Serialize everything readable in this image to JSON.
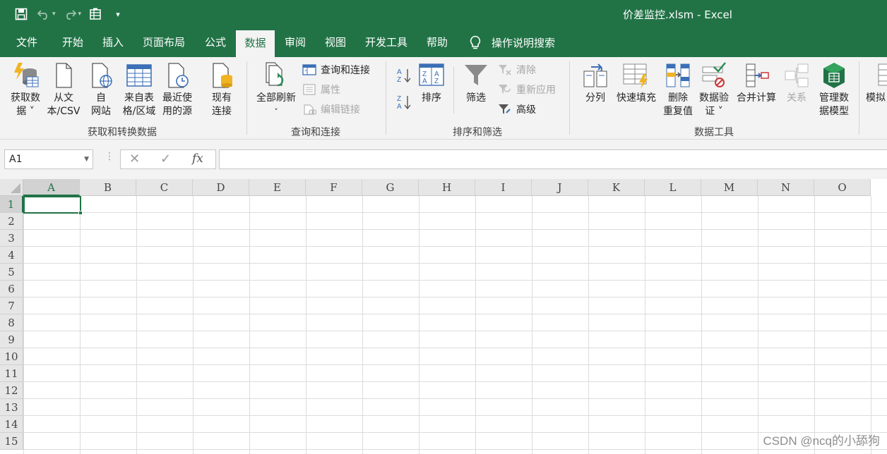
{
  "window": {
    "title": "价差监控.xlsm  -  Excel"
  },
  "quick_access": [
    {
      "name": "save-icon"
    },
    {
      "name": "undo-icon"
    },
    {
      "name": "redo-icon"
    },
    {
      "name": "form-icon"
    },
    {
      "name": "customize-qat-icon"
    }
  ],
  "tabs": [
    {
      "label": "文件"
    },
    {
      "label": "开始"
    },
    {
      "label": "插入"
    },
    {
      "label": "页面布局"
    },
    {
      "label": "公式"
    },
    {
      "label": "数据",
      "active": true
    },
    {
      "label": "审阅"
    },
    {
      "label": "视图"
    },
    {
      "label": "开发工具"
    },
    {
      "label": "帮助"
    }
  ],
  "tell_me": {
    "label": "操作说明搜索",
    "icon": "lightbulb-icon"
  },
  "ribbon": {
    "get_transform": {
      "label": "获取和转换数据",
      "buttons": [
        {
          "line1": "获取数",
          "line2": "据 ˅",
          "icon": "get-data-icon"
        },
        {
          "line1": "从文",
          "line2": "本/CSV",
          "icon": "from-text-icon"
        },
        {
          "line1": "自",
          "line2": "网站",
          "icon": "from-web-icon"
        },
        {
          "line1": "来自表",
          "line2": "格/区域",
          "icon": "from-table-icon"
        },
        {
          "line1": "最近使",
          "line2": "用的源",
          "icon": "recent-sources-icon"
        },
        {
          "line1": "现有",
          "line2": "连接",
          "icon": "existing-connections-icon"
        }
      ]
    },
    "queries": {
      "label": "查询和连接",
      "refresh": {
        "line1": "全部刷新",
        "line2": "˅",
        "icon": "refresh-all-icon"
      },
      "small": [
        {
          "label": "查询和连接",
          "disabled": false,
          "icon": "queries-connections-icon"
        },
        {
          "label": "属性",
          "disabled": true,
          "icon": "properties-icon"
        },
        {
          "label": "编辑链接",
          "disabled": true,
          "icon": "edit-links-icon"
        }
      ]
    },
    "sort_filter": {
      "label": "排序和筛选",
      "sort_label": "排序",
      "filter_label": "筛选",
      "small": [
        {
          "label": "清除",
          "disabled": true,
          "icon": "clear-filter-icon"
        },
        {
          "label": "重新应用",
          "disabled": true,
          "icon": "reapply-icon"
        },
        {
          "label": "高级",
          "disabled": false,
          "icon": "advanced-filter-icon"
        }
      ]
    },
    "data_tools": {
      "label": "数据工具",
      "buttons": [
        {
          "line1": "分列",
          "line2": "",
          "icon": "text-to-columns-icon",
          "disabled": false
        },
        {
          "line1": "快速填充",
          "line2": "",
          "icon": "flash-fill-icon",
          "disabled": false
        },
        {
          "line1": "删除",
          "line2": "重复值",
          "icon": "remove-duplicates-icon",
          "disabled": false
        },
        {
          "line1": "数据验",
          "line2": "证 ˅",
          "icon": "data-validation-icon",
          "disabled": false
        },
        {
          "line1": "合并计算",
          "line2": "",
          "icon": "consolidate-icon",
          "disabled": false
        },
        {
          "line1": "关系",
          "line2": "",
          "icon": "relationships-icon",
          "disabled": true
        },
        {
          "line1": "管理数",
          "line2": "据模型",
          "icon": "data-model-icon",
          "disabled": false
        }
      ]
    },
    "forecast": {
      "line1": "模拟"
    }
  },
  "formula_bar": {
    "name_box": "A1",
    "cancel": "✕",
    "enter": "✓",
    "fx": "fx",
    "value": ""
  },
  "sheet": {
    "columns": [
      "A",
      "B",
      "C",
      "D",
      "E",
      "F",
      "G",
      "H",
      "I",
      "J",
      "K",
      "L",
      "M",
      "N",
      "O"
    ],
    "rows": [
      "1",
      "2",
      "3",
      "4",
      "5",
      "6",
      "7",
      "8",
      "9",
      "10",
      "11",
      "12",
      "13",
      "14",
      "15"
    ],
    "active_cell": "A1"
  },
  "watermark": "CSDN @ncq的小舔狗",
  "colors": {
    "brand_green": "#217346",
    "ribbon_bg": "#f3f3f3"
  }
}
